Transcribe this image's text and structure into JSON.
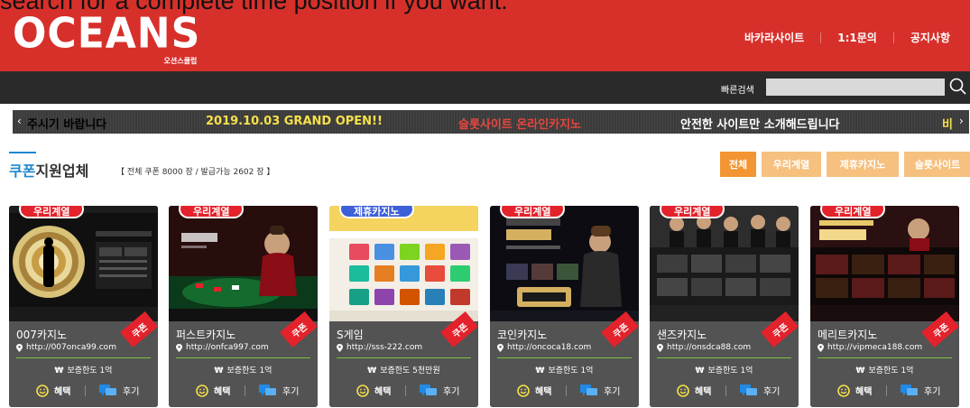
{
  "overlay_hint": "search for a complete time position if you want.",
  "header": {
    "logo_text": "OCEANS",
    "logo_sub": "오션스클럽",
    "nav": [
      "바카라사이트",
      "1:1문의",
      "공지사항"
    ]
  },
  "search": {
    "label": "빠른검색",
    "value": ""
  },
  "marquee": {
    "left_arrow": "‹",
    "right_arrow": "›",
    "items": [
      {
        "text": "주시기 바랍니다",
        "color": "#ffffff"
      },
      {
        "text": "2019.10.03 GRAND OPEN!!",
        "color": "#f6e04b"
      },
      {
        "text": "슬롯사이트 온라인카지노",
        "color": "#e8463f"
      },
      {
        "text": "안전한 사이트만 소개해드립니다",
        "color": "#ffffff"
      },
      {
        "text": "비",
        "color": "#f6e04b"
      }
    ]
  },
  "section": {
    "title_blue": "쿠폰",
    "title_dark": "지원업체",
    "subtitle": "【 전체 쿠폰 8000 장 / 발급가능 2602 장 】"
  },
  "filters": [
    {
      "label": "전체",
      "active": true
    },
    {
      "label": "우리계열",
      "active": false
    },
    {
      "label": "제휴카지노",
      "active": false
    },
    {
      "label": "슬롯사이트",
      "active": false
    }
  ],
  "cards": [
    {
      "badge": "우리계열",
      "badge_color": "red",
      "name": "007카지노",
      "url": "http://007onca99.com",
      "guarantee": "보증한도 1억",
      "benefit": "혜택",
      "review": "후기",
      "coupon": "쿠폰"
    },
    {
      "badge": "우리계열",
      "badge_color": "red",
      "name": "퍼스트카지노",
      "url": "http://onfca997.com",
      "guarantee": "보증한도 1억",
      "benefit": "혜택",
      "review": "후기",
      "coupon": "쿠폰"
    },
    {
      "badge": "제휴카지노",
      "badge_color": "blue",
      "name": "S게임",
      "url": "http://sss-222.com",
      "guarantee": "보증한도 5천만원",
      "benefit": "혜택",
      "review": "후기",
      "coupon": "쿠폰"
    },
    {
      "badge": "우리계열",
      "badge_color": "red",
      "name": "코인카지노",
      "url": "http://oncoca18.com",
      "guarantee": "보증한도 1억",
      "benefit": "혜택",
      "review": "후기",
      "coupon": "쿠폰"
    },
    {
      "badge": "우리계열",
      "badge_color": "red",
      "name": "샌즈카지노",
      "url": "http://onsdca88.com",
      "guarantee": "보증한도 1억",
      "benefit": "혜택",
      "review": "후기",
      "coupon": "쿠폰"
    },
    {
      "badge": "우리계열",
      "badge_color": "red",
      "name": "메리트카지노",
      "url": "http://vipmeca188.com",
      "guarantee": "보증한도 1억",
      "benefit": "혜택",
      "review": "후기",
      "coupon": "쿠폰"
    }
  ],
  "won_symbol": "₩"
}
